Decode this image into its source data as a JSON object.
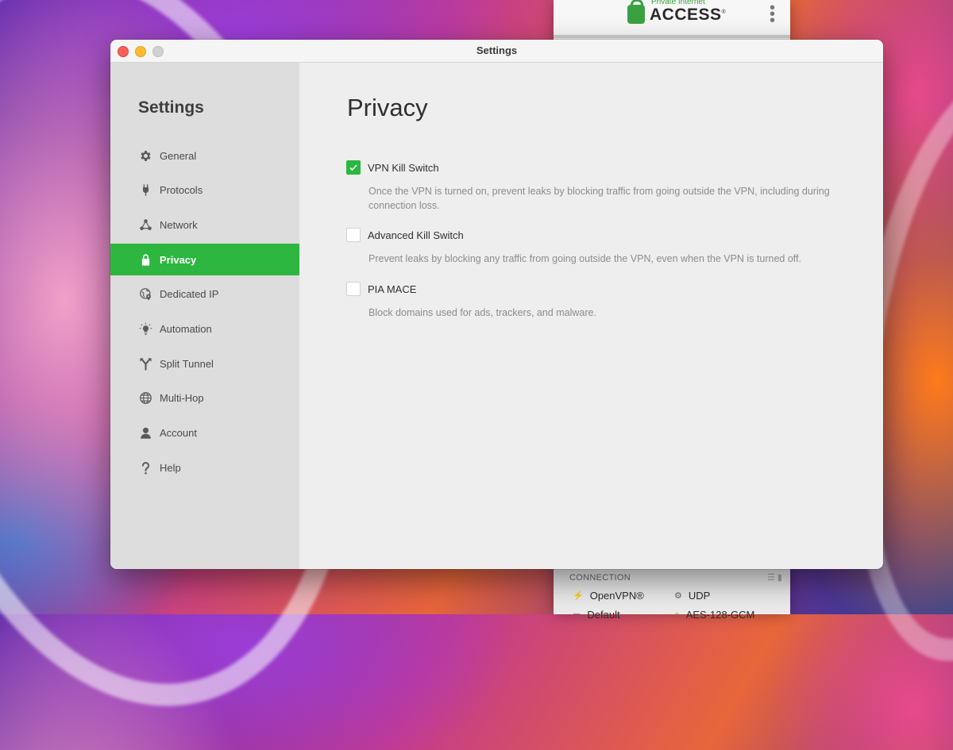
{
  "background_app": {
    "logo_small": "Private Internet",
    "logo_big": "ACCESS",
    "logo_mark": "®",
    "menu_icon": "more-vertical-icon",
    "connection_label": "CONNECTION",
    "protocol": "OpenVPN®",
    "transport": "UDP",
    "remap_partial": "Default",
    "encryption_partial": "AES-128-GCM"
  },
  "window": {
    "title": "Settings"
  },
  "sidebar": {
    "title": "Settings",
    "items": [
      {
        "label": "General",
        "icon": "gear-icon"
      },
      {
        "label": "Protocols",
        "icon": "plug-icon"
      },
      {
        "label": "Network",
        "icon": "network-icon"
      },
      {
        "label": "Privacy",
        "icon": "lock-icon",
        "active": true
      },
      {
        "label": "Dedicated IP",
        "icon": "globe-pin-icon"
      },
      {
        "label": "Automation",
        "icon": "bulb-icon"
      },
      {
        "label": "Split Tunnel",
        "icon": "split-icon"
      },
      {
        "label": "Multi-Hop",
        "icon": "globe-icon"
      },
      {
        "label": "Account",
        "icon": "person-icon"
      },
      {
        "label": "Help",
        "icon": "question-icon"
      }
    ]
  },
  "content": {
    "title": "Privacy",
    "options": [
      {
        "label": "VPN Kill Switch",
        "checked": true,
        "description": "Once the VPN is turned on, prevent leaks by blocking traffic from going outside the VPN, including during connection loss."
      },
      {
        "label": "Advanced Kill Switch",
        "checked": false,
        "description": "Prevent leaks by blocking any traffic from going outside the VPN, even when the VPN is turned off."
      },
      {
        "label": "PIA MACE",
        "checked": false,
        "description": "Block domains used for ads, trackers, and malware."
      }
    ]
  },
  "colors": {
    "accent": "#2db640",
    "sidebar_bg": "#dddddd",
    "content_bg": "#eeeeee"
  }
}
